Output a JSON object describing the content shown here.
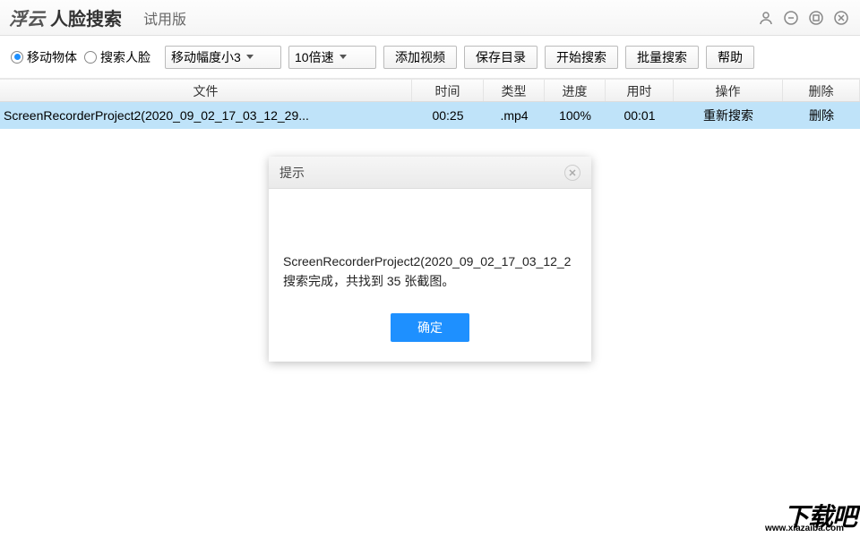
{
  "titlebar": {
    "logo1": "浮云",
    "logo2": "人脸搜索",
    "edition": "试用版"
  },
  "toolbar": {
    "radio_moving": "移动物体",
    "radio_face": "搜索人脸",
    "amplitude_select": "移动幅度小3",
    "speed_select": "10倍速",
    "add_video": "添加视频",
    "save_dir": "保存目录",
    "start_search": "开始搜索",
    "batch_search": "批量搜索",
    "help": "帮助"
  },
  "table": {
    "headers": {
      "file": "文件",
      "time": "时间",
      "type": "类型",
      "progress": "进度",
      "used": "用时",
      "operate": "操作",
      "delete": "删除"
    },
    "rows": [
      {
        "file": "ScreenRecorderProject2(2020_09_02_17_03_12_29...",
        "time": "00:25",
        "type": ".mp4",
        "progress": "100%",
        "used": "00:01",
        "operate": "重新搜索",
        "delete": "删除"
      }
    ]
  },
  "dialog": {
    "title": "提示",
    "line1": "ScreenRecorderProject2(2020_09_02_17_03_12_2",
    "line2": "搜索完成，共找到 35 张截图。",
    "ok": "确定"
  },
  "watermark": {
    "big": "下载吧",
    "small": "www.xiazaiba.com"
  }
}
